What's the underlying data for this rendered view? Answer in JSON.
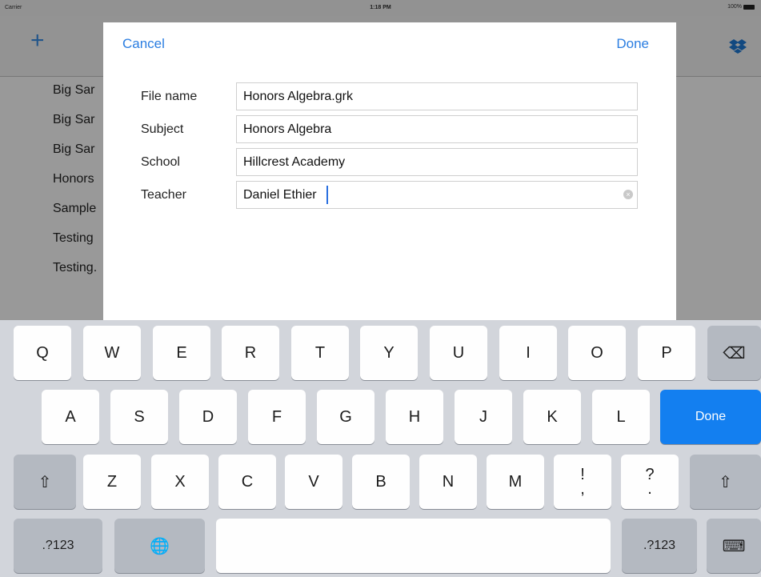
{
  "status_bar": {
    "carrier": "Carrier",
    "time": "1:18 PM",
    "battery": "100%"
  },
  "background": {
    "list_items": [
      "Big Sar",
      "Big Sar",
      "Big Sar",
      "Honors",
      "Sample",
      "Testing",
      "Testing."
    ]
  },
  "modal": {
    "cancel_label": "Cancel",
    "done_label": "Done",
    "fields": [
      {
        "label": "File name",
        "value": "Honors Algebra.grk"
      },
      {
        "label": "Subject",
        "value": "Honors Algebra"
      },
      {
        "label": "School",
        "value": "Hillcrest Academy"
      },
      {
        "label": "Teacher",
        "value": "Daniel Ethier"
      }
    ]
  },
  "keyboard": {
    "row1": [
      "Q",
      "W",
      "E",
      "R",
      "T",
      "Y",
      "U",
      "I",
      "O",
      "P"
    ],
    "row2": [
      "A",
      "S",
      "D",
      "F",
      "G",
      "H",
      "J",
      "K",
      "L"
    ],
    "row3": [
      "Z",
      "X",
      "C",
      "V",
      "B",
      "N",
      "M"
    ],
    "excl_top": "!",
    "excl_bottom": ",",
    "quest_top": "?",
    "quest_bottom": ".",
    "done_label": "Done",
    "numbers_label": ".?123",
    "shift_icon": "⇧",
    "delete_icon": "⌫",
    "globe_icon": "🌐",
    "hide_keyboard_icon": "⌨"
  },
  "colors": {
    "accent": "#2a7de1",
    "done_key": "#137ff0"
  }
}
